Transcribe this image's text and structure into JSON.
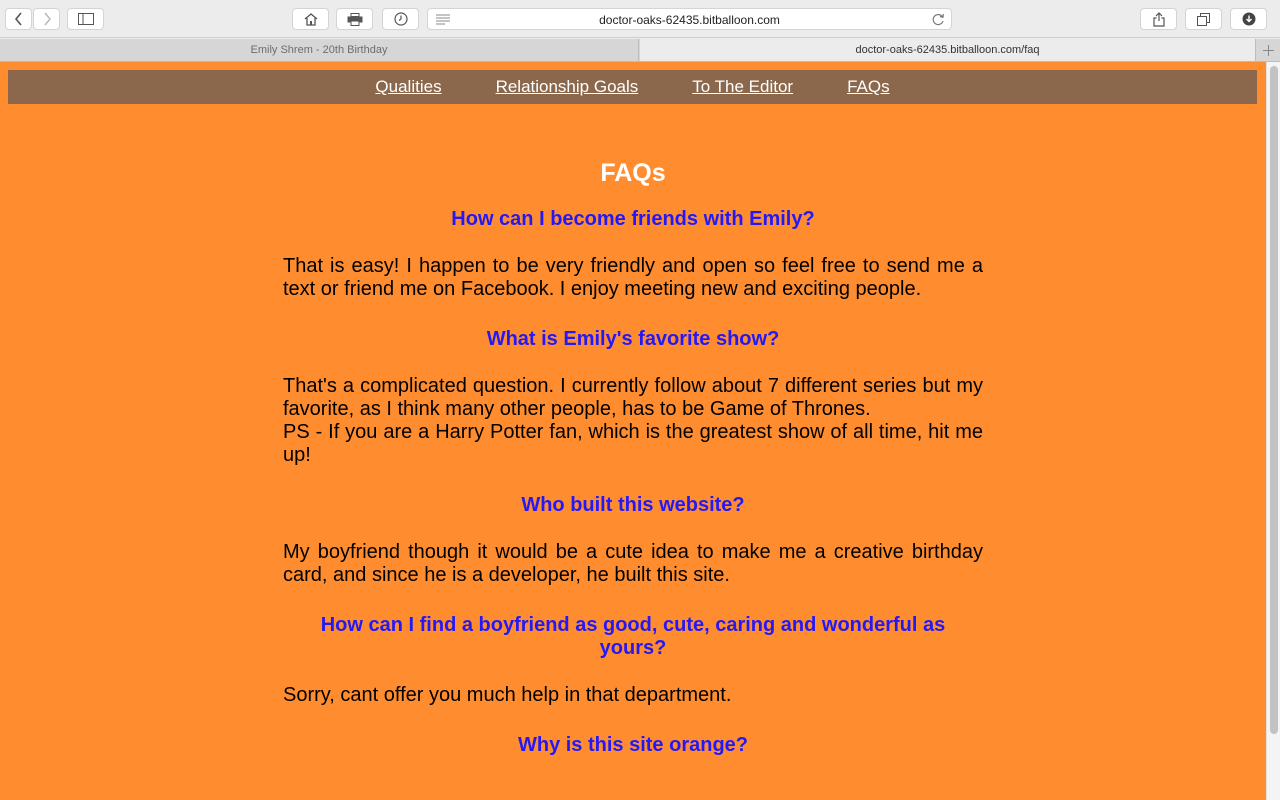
{
  "browser": {
    "url": "doctor-oaks-62435.bitballoon.com",
    "tabs": [
      {
        "label": "Emily Shrem - 20th Birthday"
      },
      {
        "label": "doctor-oaks-62435.bitballoon.com/faq"
      }
    ]
  },
  "nav": {
    "items": [
      "Qualities",
      "Relationship Goals",
      "To The Editor",
      "FAQs"
    ]
  },
  "page": {
    "title": "FAQs",
    "faqs": [
      {
        "q": "How can I become friends with Emily?",
        "a": "That is easy! I happen to be very friendly and open so feel free to send me a text or friend me on Facebook. I enjoy meeting new and exciting people."
      },
      {
        "q": "What is Emily's favorite show?",
        "a": "That's a complicated question. I currently follow about 7 different series but my favorite, as I think many other people, has to be Game of Thrones.",
        "a2": "PS - If you are a Harry Potter fan, which is the greatest show of all time, hit me up!"
      },
      {
        "q": "Who built this website?",
        "a": "My boyfriend though it would be a cute idea to make me a creative birthday card, and since he is a developer, he built this site."
      },
      {
        "q": "How can I find a boyfriend as good, cute, caring and wonderful as yours?",
        "a": "Sorry, cant offer you much help in that department."
      },
      {
        "q": "Why is this site orange?"
      }
    ]
  },
  "colors": {
    "page_bg": "#ff8d30",
    "nav_bg": "#8b684c",
    "question": "#2419f5",
    "title": "#ffffff"
  }
}
